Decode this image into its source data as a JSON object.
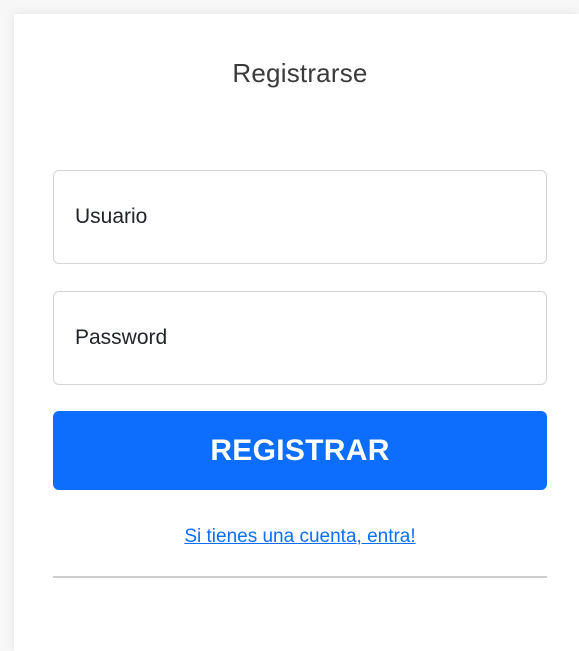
{
  "form": {
    "title": "Registrarse",
    "username_placeholder": "Usuario",
    "password_placeholder": "Password",
    "submit_label": "REGISTRAR",
    "login_link_text": "Si tienes una cuenta, entra!"
  },
  "colors": {
    "primary": "#0d6efd",
    "border": "#d4d4d4",
    "text": "#212529"
  }
}
